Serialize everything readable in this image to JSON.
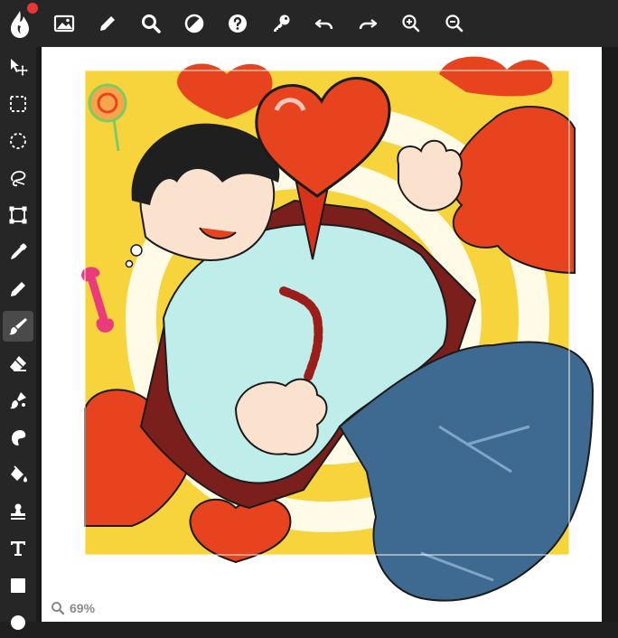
{
  "toolbar": {
    "buttons": [
      {
        "name": "app-menu",
        "icon": "logo-flame-icon"
      },
      {
        "name": "open-image",
        "icon": "image-icon"
      },
      {
        "name": "edit",
        "icon": "pencil-icon"
      },
      {
        "name": "search",
        "icon": "search-icon"
      },
      {
        "name": "adjust",
        "icon": "half-circle-icon"
      },
      {
        "name": "help",
        "icon": "help-icon"
      },
      {
        "name": "key",
        "icon": "key-icon"
      },
      {
        "name": "undo",
        "icon": "undo-icon"
      },
      {
        "name": "redo",
        "icon": "redo-icon"
      },
      {
        "name": "zoom-in",
        "icon": "zoom-in-icon"
      },
      {
        "name": "zoom-out",
        "icon": "zoom-out-icon"
      }
    ],
    "notification_color": "#e53935"
  },
  "sidebar": {
    "tools": [
      {
        "name": "move",
        "icon": "move-icon"
      },
      {
        "name": "rect-select",
        "icon": "rect-select-icon"
      },
      {
        "name": "ellipse-select",
        "icon": "ellipse-select-icon"
      },
      {
        "name": "lasso",
        "icon": "lasso-icon"
      },
      {
        "name": "transform",
        "icon": "transform-icon"
      },
      {
        "name": "eyedropper",
        "icon": "eyedropper-icon"
      },
      {
        "name": "pencil",
        "icon": "pencil-icon"
      },
      {
        "name": "brush",
        "icon": "brush-icon",
        "active": true
      },
      {
        "name": "eraser",
        "icon": "eraser-icon"
      },
      {
        "name": "mixer-brush",
        "icon": "mixer-brush-icon"
      },
      {
        "name": "smudge",
        "icon": "smudge-icon"
      },
      {
        "name": "fill",
        "icon": "paint-bucket-icon"
      },
      {
        "name": "clone",
        "icon": "clone-stamp-icon"
      },
      {
        "name": "text",
        "icon": "text-icon"
      },
      {
        "name": "shape",
        "icon": "square-icon"
      },
      {
        "name": "ellipse",
        "icon": "circle-icon"
      }
    ]
  },
  "status": {
    "zoom_label": "69%"
  },
  "colors": {
    "chrome": "#262626",
    "icon": "#ffffff",
    "artwork_yellow": "#f7d33c",
    "artwork_red": "#e8431f",
    "artwork_shirt": "#bfeeea",
    "artwork_jeans": "#3e6a92"
  }
}
